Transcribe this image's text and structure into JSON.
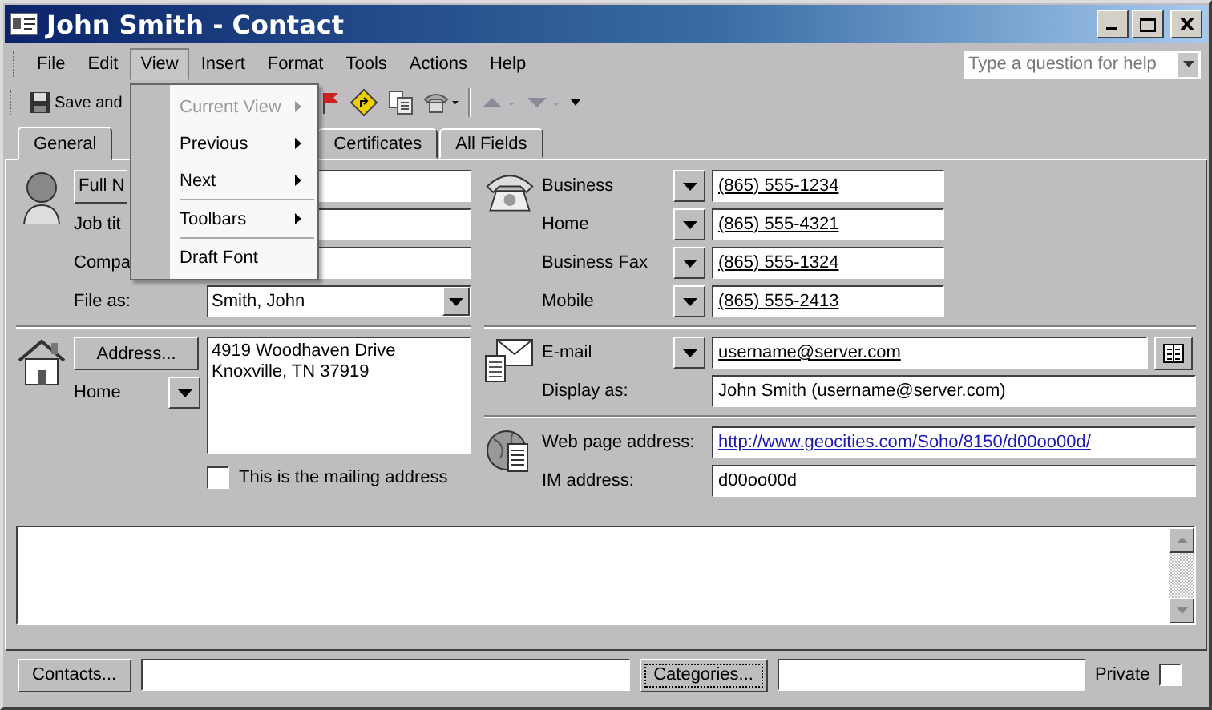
{
  "window": {
    "title": "John Smith - Contact"
  },
  "menu_bar": [
    {
      "label": "File",
      "selected": false
    },
    {
      "label": "Edit",
      "selected": false
    },
    {
      "label": "View",
      "selected": true
    },
    {
      "label": "Insert",
      "selected": false
    },
    {
      "label": "Format",
      "selected": false
    },
    {
      "label": "Tools",
      "selected": false
    },
    {
      "label": "Actions",
      "selected": false
    },
    {
      "label": "Help",
      "selected": false
    }
  ],
  "help_box": {
    "placeholder": "Type a question for help"
  },
  "toolbar": {
    "save_button": "Save and"
  },
  "view_menu": [
    {
      "kind": "submenu",
      "label": "Current View",
      "disabled": true
    },
    {
      "kind": "submenu",
      "label": "Previous",
      "disabled": false
    },
    {
      "kind": "submenu",
      "label": "Next",
      "disabled": false
    },
    {
      "kind": "separator"
    },
    {
      "kind": "submenu",
      "label": "Toolbars",
      "disabled": false
    },
    {
      "kind": "separator"
    },
    {
      "kind": "command",
      "label": "Draft Font",
      "disabled": false
    }
  ],
  "tabs": [
    {
      "label": "General",
      "selected": true
    },
    {
      "label": "Certificates",
      "selected": false
    },
    {
      "label": "All Fields",
      "selected": false
    }
  ],
  "name_section": {
    "full_name_button": "Full N",
    "job_title_label": "Job tit",
    "company_label": "Compa",
    "file_as_label": "File as:",
    "file_as_value": "Smith, John"
  },
  "address": {
    "button": "Address...",
    "type": "Home",
    "lines": [
      "4919 Woodhaven Drive",
      "Knoxville, TN  37919"
    ],
    "mailing_label": "This is the mailing address",
    "mailing_checked": false
  },
  "phones": [
    {
      "label": "Business",
      "value": "(865) 555-1234"
    },
    {
      "label": "Home",
      "value": "(865) 555-4321"
    },
    {
      "label": "Business Fax",
      "value": "(865) 555-1324"
    },
    {
      "label": "Mobile",
      "value": "(865) 555-2413"
    }
  ],
  "email": {
    "label": "E-mail",
    "value": "username@server.com",
    "display_label": "Display as:",
    "display_value": "John Smith (username@server.com)"
  },
  "web": {
    "label": "Web page address:",
    "value": "http://www.geocities.com/Soho/8150/d00oo00d/",
    "im_label": "IM address:",
    "im_value": "d00oo00d"
  },
  "bottom": {
    "contacts_button": "Contacts...",
    "categories_button": "Categories...",
    "private_label": "Private",
    "private_checked": false
  }
}
